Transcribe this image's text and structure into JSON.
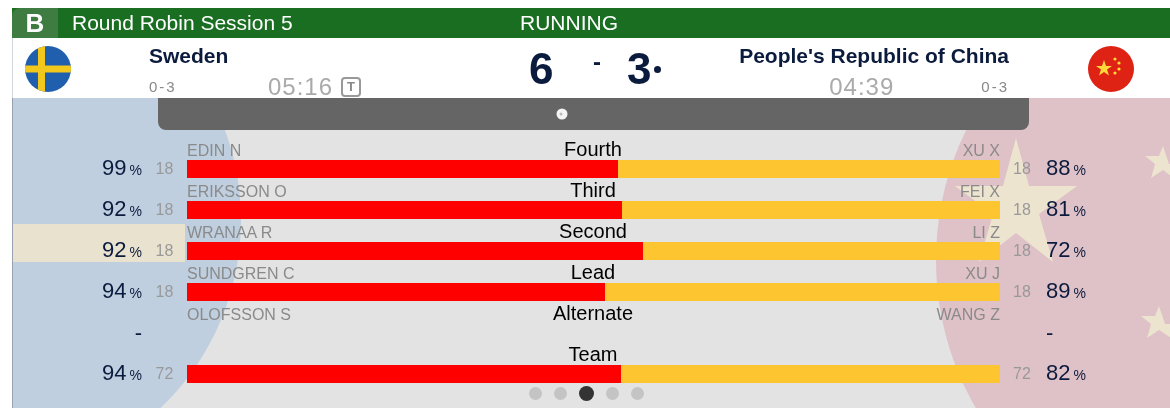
{
  "header": {
    "sheet": "B",
    "title": "Round Robin Session 5",
    "status": "RUNNING"
  },
  "teams": [
    {
      "name": "Sweden",
      "record": "0-3",
      "time": "05:16",
      "timeout": "T",
      "score": "6",
      "hammer": false
    },
    {
      "name": "People's Republic of China",
      "record": "0-3",
      "time": "04:39",
      "score": "3",
      "hammer": true
    }
  ],
  "score_separator": "-",
  "rows": [
    {
      "kind": "player",
      "position": "Fourth",
      "left": {
        "name": "EDIN N",
        "count": "18",
        "pct": "99",
        "unit": "%"
      },
      "right": {
        "name": "XU X",
        "count": "18",
        "pct": "88",
        "unit": "%"
      },
      "level": 0.53
    },
    {
      "kind": "player",
      "position": "Third",
      "left": {
        "name": "ERIKSSON O",
        "count": "18",
        "pct": "92",
        "unit": "%"
      },
      "right": {
        "name": "FEI X",
        "count": "18",
        "pct": "81",
        "unit": "%"
      },
      "level": 0.535
    },
    {
      "kind": "player",
      "position": "Second",
      "left": {
        "name": "WRANAA R",
        "count": "18",
        "pct": "92",
        "unit": "%"
      },
      "right": {
        "name": "LI Z",
        "count": "18",
        "pct": "72",
        "unit": "%"
      },
      "level": 0.561
    },
    {
      "kind": "player",
      "position": "Lead",
      "left": {
        "name": "SUNDGREN C",
        "count": "18",
        "pct": "94",
        "unit": "%"
      },
      "right": {
        "name": "XU J",
        "count": "18",
        "pct": "89",
        "unit": "%"
      },
      "level": 0.514
    },
    {
      "kind": "alternate",
      "position": "Alternate",
      "left": {
        "name": "OLOFSSON S",
        "pct": "-"
      },
      "right": {
        "name": "WANG Z",
        "pct": "-"
      }
    },
    {
      "kind": "team",
      "position": "Team",
      "left": {
        "count": "72",
        "pct": "94",
        "unit": "%"
      },
      "right": {
        "count": "72",
        "pct": "82",
        "unit": "%"
      },
      "level": 0.534
    }
  ],
  "pages": [
    {
      "selected": false
    },
    {
      "selected": false
    },
    {
      "selected": true
    },
    {
      "selected": false
    },
    {
      "selected": false
    }
  ]
}
